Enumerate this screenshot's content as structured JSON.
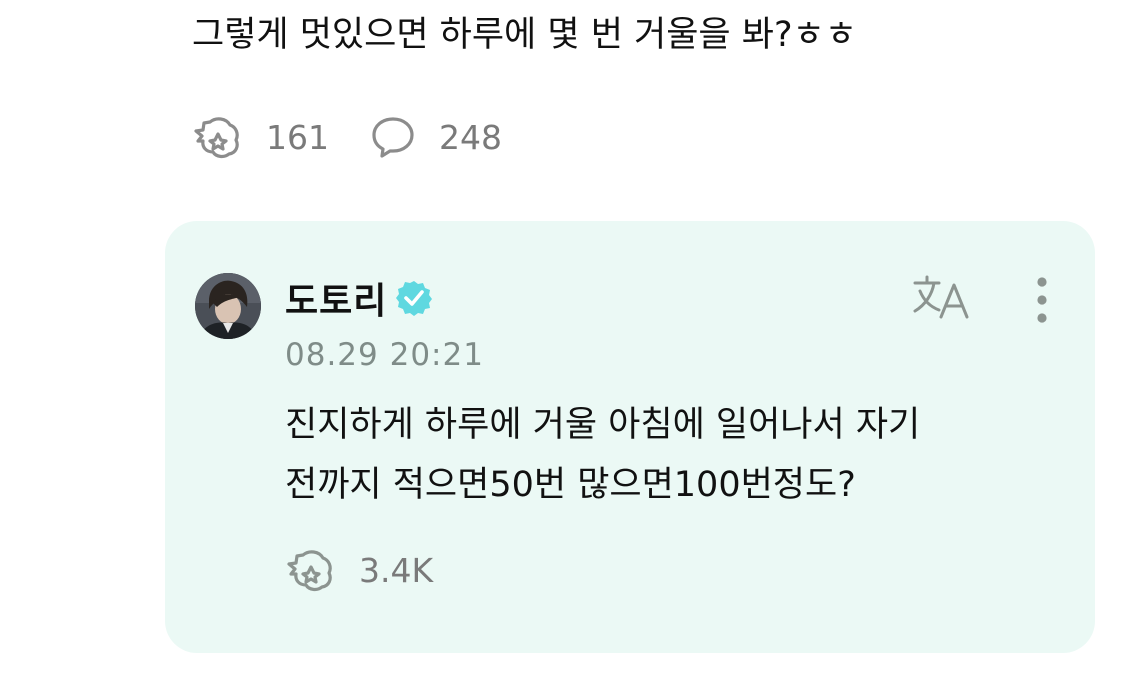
{
  "post": {
    "text": "그렇게 멋있으면 하루에 몇 번 거울을 봐?ㅎㅎ",
    "like_icon": "like-icon",
    "like_count": "161",
    "comment_icon": "comment-icon",
    "comment_count": "248"
  },
  "reply": {
    "author": "도토리",
    "verified_icon": "verified-badge-icon",
    "time": "08.29 20:21",
    "text_lines": [
      "진지하게 하루에 거울 아침에 일어나서 자기",
      "전까지 적으면50번 많으면100번정도?"
    ],
    "like_icon": "like-icon",
    "like_count": "3.4K",
    "translate_icon": "translate-icon",
    "more_icon": "more-vertical-icon"
  },
  "colors": {
    "card_background": "#ebf9f5",
    "verified": "#5fd8e0",
    "muted_text": "#7f8c88",
    "icon_gray": "#8c8c8c"
  }
}
